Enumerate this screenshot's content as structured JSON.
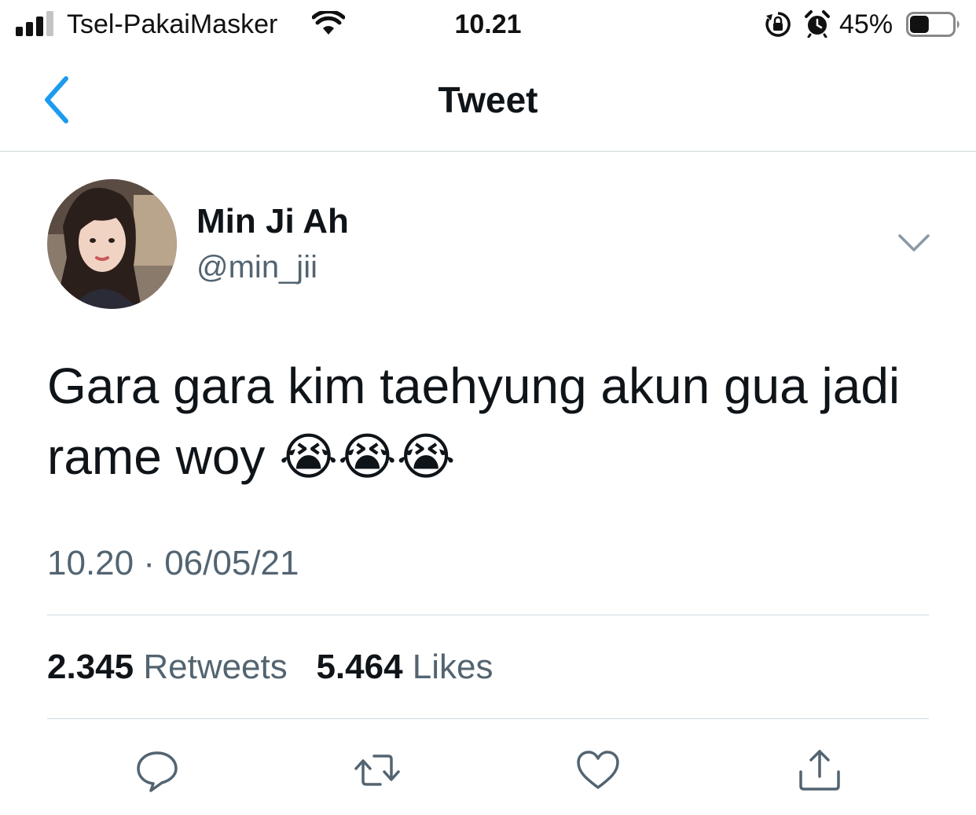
{
  "status_bar": {
    "carrier": "Tsel-PakaiMasker",
    "time": "10.21",
    "battery_percent": "45%",
    "battery_level": 0.45,
    "icons": [
      "signal-icon",
      "wifi-icon",
      "rotation-lock-icon",
      "alarm-icon",
      "battery-icon"
    ]
  },
  "nav": {
    "title": "Tweet",
    "back_icon": "chevron-left-icon"
  },
  "tweet": {
    "author_name": "Min Ji Ah",
    "author_handle": "@min_jii",
    "text": "Gara gara kim taehyung akun gua jadi rame woy 😭😭😭",
    "timestamp": "10.20 · 06/05/21",
    "retweet_count": "2.345",
    "retweet_label": "Retweets",
    "like_count": "5.464",
    "like_label": "Likes"
  },
  "actions": [
    "reply-icon",
    "retweet-icon",
    "like-icon",
    "share-icon"
  ],
  "colors": {
    "accent": "#1d9bf0",
    "text_primary": "#0f1419",
    "text_secondary": "#536471",
    "divider": "#cfd9de"
  }
}
